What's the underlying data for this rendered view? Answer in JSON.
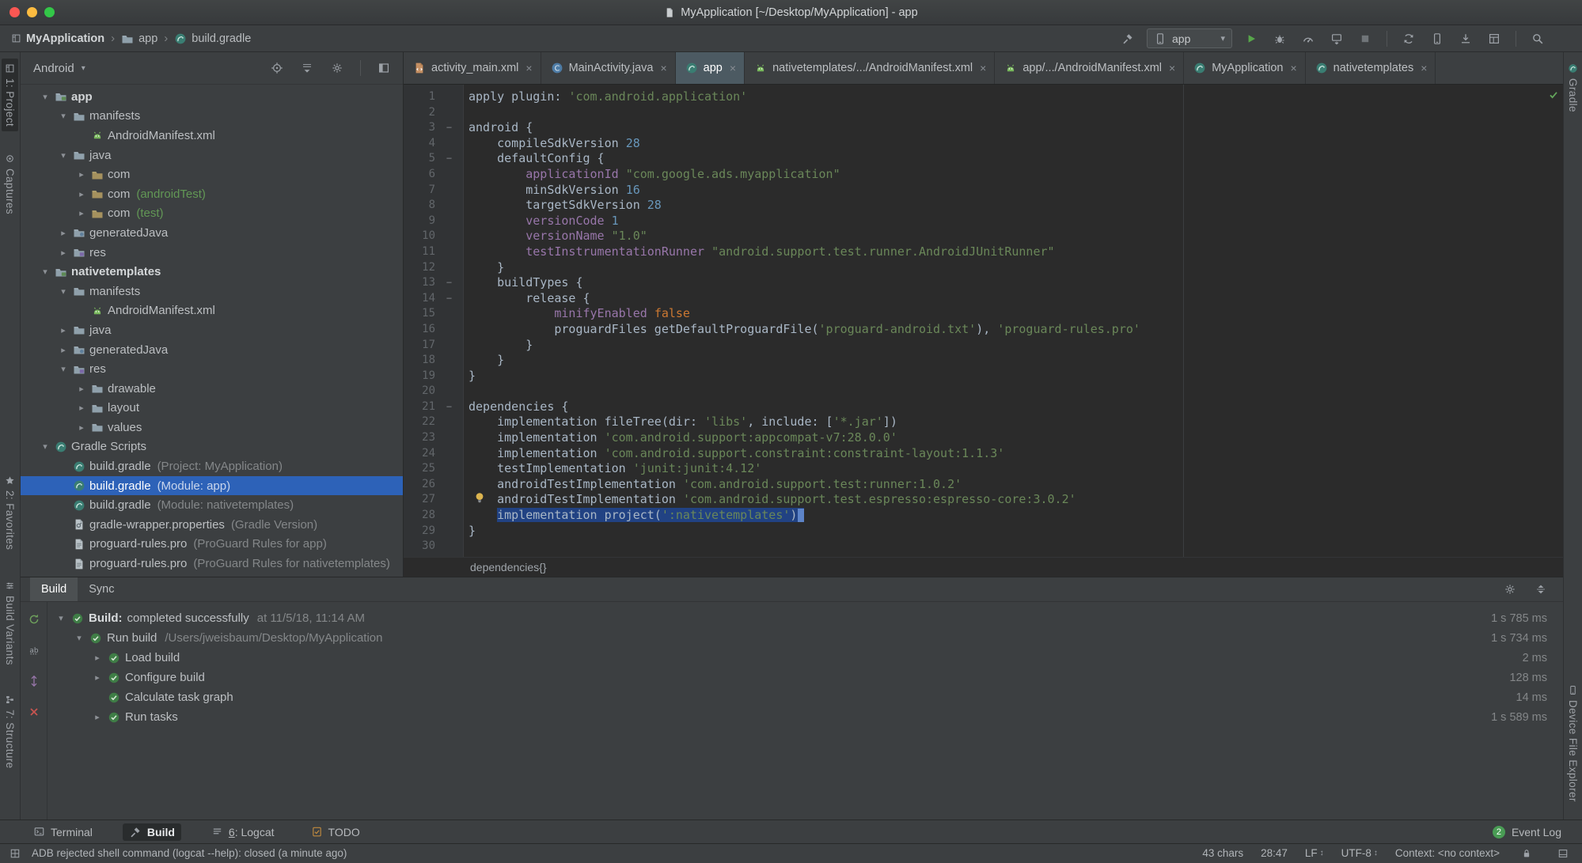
{
  "titlebar": {
    "title": "MyApplication [~/Desktop/MyApplication] - app"
  },
  "toolbar": {
    "breadcrumbs": [
      {
        "label": "MyApplication",
        "icon": "project-tool"
      },
      {
        "label": "app",
        "icon": "folder"
      },
      {
        "label": "build.gradle",
        "icon": "gradle"
      }
    ],
    "run_config": "app",
    "right_icons": [
      "hammer",
      "run-config",
      "play",
      "debug",
      "gauge",
      "attach",
      "stop",
      "sep",
      "sync",
      "phone",
      "download",
      "layout",
      "sep",
      "search"
    ]
  },
  "left_stripe": {
    "top": [
      {
        "label": "1: Project",
        "icon": "project-tool",
        "active": true
      },
      {
        "label": "Captures",
        "icon": "captures"
      }
    ],
    "bottom": [
      {
        "label": "2: Favorites",
        "icon": "star"
      },
      {
        "label": "Build Variants",
        "icon": "variants"
      },
      {
        "label": "7: Structure",
        "icon": "structure"
      }
    ]
  },
  "right_stripe": {
    "top": [
      {
        "label": "Gradle",
        "icon": "gradle-small"
      }
    ],
    "bottom": [
      {
        "label": "Device File Explorer",
        "icon": "phone-small"
      }
    ]
  },
  "project": {
    "selector": "Android",
    "header_icons": [
      "target",
      "collapse-all",
      "gear",
      "sep",
      "hide"
    ],
    "tree": [
      {
        "level": 0,
        "chevron": "down",
        "icon": "module",
        "name": "app",
        "bold": true
      },
      {
        "level": 1,
        "chevron": "down",
        "icon": "folder",
        "name": "manifests"
      },
      {
        "level": 2,
        "chevron": "none",
        "icon": "android-file",
        "name": "AndroidManifest.xml"
      },
      {
        "level": 1,
        "chevron": "down",
        "icon": "folder",
        "name": "java"
      },
      {
        "level": 2,
        "chevron": "right",
        "icon": "package",
        "name": "com"
      },
      {
        "level": 2,
        "chevron": "right",
        "icon": "package",
        "name": "com",
        "suffix": "(androidTest)",
        "suffix_class": "scope"
      },
      {
        "level": 2,
        "chevron": "right",
        "icon": "package",
        "name": "com",
        "suffix": "(test)",
        "suffix_class": "scope"
      },
      {
        "level": 1,
        "chevron": "right",
        "icon": "gen-folder",
        "name": "generatedJava"
      },
      {
        "level": 1,
        "chevron": "right",
        "icon": "res-folder",
        "name": "res"
      },
      {
        "level": 0,
        "chevron": "down",
        "icon": "module",
        "name": "nativetemplates",
        "bold": true
      },
      {
        "level": 1,
        "chevron": "down",
        "icon": "folder",
        "name": "manifests"
      },
      {
        "level": 2,
        "chevron": "none",
        "icon": "android-file",
        "name": "AndroidManifest.xml"
      },
      {
        "level": 1,
        "chevron": "right",
        "icon": "folder",
        "name": "java"
      },
      {
        "level": 1,
        "chevron": "right",
        "icon": "gen-folder",
        "name": "generatedJava"
      },
      {
        "level": 1,
        "chevron": "down",
        "icon": "res-folder",
        "name": "res"
      },
      {
        "level": 2,
        "chevron": "right",
        "icon": "folder",
        "name": "drawable"
      },
      {
        "level": 2,
        "chevron": "right",
        "icon": "folder",
        "name": "layout"
      },
      {
        "level": 2,
        "chevron": "right",
        "icon": "folder",
        "name": "values"
      },
      {
        "level": 0,
        "chevron": "down",
        "icon": "gradle",
        "name": "Gradle Scripts"
      },
      {
        "level": 1,
        "chevron": "none",
        "icon": "gradle",
        "name": "build.gradle",
        "suffix": "(Project: MyApplication)"
      },
      {
        "level": 1,
        "chevron": "none",
        "icon": "gradle",
        "name": "build.gradle",
        "suffix": "(Module: app)",
        "selected": true
      },
      {
        "level": 1,
        "chevron": "none",
        "icon": "gradle",
        "name": "build.gradle",
        "suffix": "(Module: nativetemplates)"
      },
      {
        "level": 1,
        "chevron": "none",
        "icon": "wrench-file",
        "name": "gradle-wrapper.properties",
        "suffix": "(Gradle Version)"
      },
      {
        "level": 1,
        "chevron": "none",
        "icon": "file",
        "name": "proguard-rules.pro",
        "suffix": "(ProGuard Rules for app)"
      },
      {
        "level": 1,
        "chevron": "none",
        "icon": "file",
        "name": "proguard-rules.pro",
        "suffix": "(ProGuard Rules for nativetemplates)"
      }
    ]
  },
  "editor": {
    "tabs": [
      {
        "icon": "xml-file",
        "label": "activity_main.xml"
      },
      {
        "icon": "class",
        "label": "MainActivity.java"
      },
      {
        "icon": "gradle",
        "label": "app",
        "selected": true
      },
      {
        "icon": "android-file",
        "label": "nativetemplates/.../AndroidManifest.xml"
      },
      {
        "icon": "android-file",
        "label": "app/.../AndroidManifest.xml"
      },
      {
        "icon": "gradle",
        "label": "MyApplication"
      },
      {
        "icon": "gradle",
        "label": "nativetemplates"
      }
    ],
    "breadcrumb": "dependencies{}",
    "code": {
      "lines": [
        {
          "n": 1,
          "tokens": [
            [
              "p",
              "apply plugin: "
            ],
            [
              "s",
              "'com.android.application'"
            ]
          ]
        },
        {
          "n": 2,
          "tokens": []
        },
        {
          "n": 3,
          "fold": true,
          "tokens": [
            [
              "p",
              "android {"
            ]
          ]
        },
        {
          "n": 4,
          "tokens": [
            [
              "p",
              "    compileSdkVersion "
            ],
            [
              "n",
              "28"
            ]
          ]
        },
        {
          "n": 5,
          "fold": true,
          "tokens": [
            [
              "p",
              "    defaultConfig {"
            ]
          ]
        },
        {
          "n": 6,
          "tokens": [
            [
              "p",
              "        "
            ],
            [
              "f",
              "applicationId"
            ],
            [
              "p",
              " "
            ],
            [
              "s",
              "\"com.google.ads.myapplication\""
            ]
          ]
        },
        {
          "n": 7,
          "tokens": [
            [
              "p",
              "        minSdkVersion "
            ],
            [
              "n",
              "16"
            ]
          ]
        },
        {
          "n": 8,
          "tokens": [
            [
              "p",
              "        targetSdkVersion "
            ],
            [
              "n",
              "28"
            ]
          ]
        },
        {
          "n": 9,
          "tokens": [
            [
              "p",
              "        "
            ],
            [
              "f",
              "versionCode"
            ],
            [
              "p",
              " "
            ],
            [
              "n",
              "1"
            ]
          ]
        },
        {
          "n": 10,
          "tokens": [
            [
              "p",
              "        "
            ],
            [
              "f",
              "versionName"
            ],
            [
              "p",
              " "
            ],
            [
              "s",
              "\"1.0\""
            ]
          ]
        },
        {
          "n": 11,
          "tokens": [
            [
              "p",
              "        "
            ],
            [
              "f",
              "testInstrumentationRunner"
            ],
            [
              "p",
              " "
            ],
            [
              "s",
              "\"android.support.test.runner.AndroidJUnitRunner\""
            ]
          ]
        },
        {
          "n": 12,
          "tokens": [
            [
              "p",
              "    }"
            ]
          ]
        },
        {
          "n": 13,
          "fold": true,
          "tokens": [
            [
              "p",
              "    buildTypes {"
            ]
          ]
        },
        {
          "n": 14,
          "fold": true,
          "tokens": [
            [
              "p",
              "        release {"
            ]
          ]
        },
        {
          "n": 15,
          "tokens": [
            [
              "p",
              "            "
            ],
            [
              "f",
              "minifyEnabled"
            ],
            [
              "p",
              " "
            ],
            [
              "k",
              "false"
            ]
          ]
        },
        {
          "n": 16,
          "tokens": [
            [
              "p",
              "            proguardFiles getDefaultProguardFile("
            ],
            [
              "s",
              "'proguard-android.txt'"
            ],
            [
              "p",
              "), "
            ],
            [
              "s",
              "'proguard-rules.pro'"
            ]
          ]
        },
        {
          "n": 17,
          "tokens": [
            [
              "p",
              "        }"
            ]
          ]
        },
        {
          "n": 18,
          "tokens": [
            [
              "p",
              "    }"
            ]
          ]
        },
        {
          "n": 19,
          "tokens": [
            [
              "p",
              "}"
            ]
          ]
        },
        {
          "n": 20,
          "tokens": []
        },
        {
          "n": 21,
          "fold": true,
          "tokens": [
            [
              "p",
              "dependencies {"
            ]
          ]
        },
        {
          "n": 22,
          "tokens": [
            [
              "p",
              "    implementation fileTree(dir: "
            ],
            [
              "s",
              "'libs'"
            ],
            [
              "p",
              ", include: ["
            ],
            [
              "s",
              "'*.jar'"
            ],
            [
              "p",
              "])"
            ]
          ]
        },
        {
          "n": 23,
          "tokens": [
            [
              "p",
              "    implementation "
            ],
            [
              "s",
              "'com.android.support:appcompat-v7:28.0.0'"
            ]
          ]
        },
        {
          "n": 24,
          "tokens": [
            [
              "p",
              "    implementation "
            ],
            [
              "s",
              "'com.android.support.constraint:constraint-layout:1.1.3'"
            ]
          ]
        },
        {
          "n": 25,
          "tokens": [
            [
              "p",
              "    testImplementation "
            ],
            [
              "s",
              "'junit:junit:4.12'"
            ]
          ]
        },
        {
          "n": 26,
          "tokens": [
            [
              "p",
              "    androidTestImplementation "
            ],
            [
              "s",
              "'com.android.support.test:runner:1.0.2'"
            ]
          ]
        },
        {
          "n": 27,
          "tokens": [
            [
              "p",
              "    androidTestImplementation "
            ],
            [
              "s",
              "'com.android.support.test.espresso:espresso-core:3.0.2'"
            ]
          ]
        },
        {
          "n": 28,
          "sel_start": 1,
          "caret": true,
          "tokens": [
            [
              "p",
              "    "
            ],
            [
              "p",
              "implementation project("
            ],
            [
              "s",
              "':nativetemplates'"
            ],
            [
              "p",
              ")"
            ]
          ]
        },
        {
          "n": 29,
          "tokens": [
            [
              "p",
              "}"
            ]
          ]
        },
        {
          "n": 30,
          "tokens": []
        }
      ]
    }
  },
  "build": {
    "tabs": [
      {
        "label": "Build",
        "selected": true
      },
      {
        "label": "Sync"
      }
    ],
    "header_icons": [
      "gear",
      "collapse"
    ],
    "tool_icons": [
      "restart",
      "filter-ab",
      "expand",
      "close-red"
    ],
    "rows": [
      {
        "level": 0,
        "chevron": "down",
        "strong": "Build:",
        "label": "completed successfully",
        "detail": "at 11/5/18, 11:14 AM",
        "duration": "1 s 785 ms"
      },
      {
        "level": 1,
        "chevron": "down",
        "label": "Run build",
        "detail": "/Users/jweisbaum/Desktop/MyApplication",
        "duration": "1 s 734 ms"
      },
      {
        "level": 2,
        "chevron": "right",
        "label": "Load build",
        "duration": "2 ms"
      },
      {
        "level": 2,
        "chevron": "right",
        "label": "Configure build",
        "duration": "128 ms"
      },
      {
        "level": 2,
        "chevron": "none",
        "label": "Calculate task graph",
        "duration": "14 ms"
      },
      {
        "level": 2,
        "chevron": "right",
        "label": "Run tasks",
        "duration": "1 s 589 ms"
      }
    ]
  },
  "bottom_bar": {
    "items": [
      {
        "label": "Terminal",
        "icon": "terminal"
      },
      {
        "label": "Build",
        "icon": "hammer",
        "active": true
      },
      {
        "label": "6: Logcat",
        "icon": "lines",
        "mnemonic": true
      },
      {
        "label": "TODO",
        "icon": "todo"
      }
    ],
    "right": {
      "label": "Event Log",
      "badge": "2"
    }
  },
  "status_bar": {
    "message": "ADB rejected shell command (logcat --help): closed (a minute ago)",
    "items": [
      {
        "label": "43 chars"
      },
      {
        "label": "28:47"
      },
      {
        "label": "LF",
        "arrows": true
      },
      {
        "label": "UTF-8",
        "arrows": true
      },
      {
        "label": "Context: <no context>"
      },
      {
        "icon": "lock"
      },
      {
        "icon": "panel"
      }
    ]
  }
}
